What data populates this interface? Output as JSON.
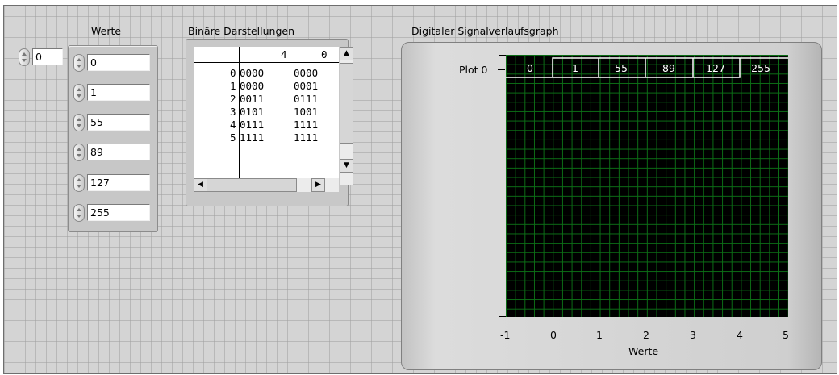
{
  "labels": {
    "werte": "Werte",
    "binaer": "Binäre Darstellungen",
    "graph": "Digitaler Signalverlaufsgraph"
  },
  "index_control": "0",
  "values": [
    "0",
    "1",
    "55",
    "89",
    "127",
    "255"
  ],
  "table": {
    "headers": [
      "4",
      "0"
    ],
    "rows": [
      {
        "idx": "0",
        "hi": "0000",
        "lo": "0000"
      },
      {
        "idx": "1",
        "hi": "0000",
        "lo": "0001"
      },
      {
        "idx": "2",
        "hi": "0011",
        "lo": "0111"
      },
      {
        "idx": "3",
        "hi": "0101",
        "lo": "1001"
      },
      {
        "idx": "4",
        "hi": "0111",
        "lo": "1111"
      },
      {
        "idx": "5",
        "hi": "1111",
        "lo": "1111"
      }
    ]
  },
  "graph": {
    "plot_label": "Plot 0",
    "bus_values": [
      "0",
      "1",
      "55",
      "89",
      "127",
      "255"
    ],
    "x_ticks": [
      "-1",
      "0",
      "1",
      "2",
      "3",
      "4",
      "5"
    ],
    "xlabel": "Werte"
  },
  "colors": {
    "grid": "#0c6e16",
    "plot_bg": "#000000",
    "signal": "#ffffff",
    "panel": "#d4d4d4"
  }
}
